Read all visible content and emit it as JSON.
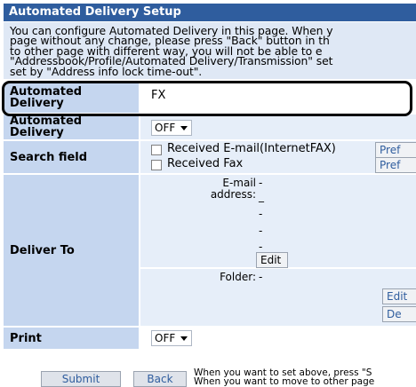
{
  "header": {
    "title": "Automated Delivery Setup"
  },
  "description": {
    "lines": [
      "You can configure Automated Delivery in this page. When y",
      "page without any change, please press \"Back\" button in th",
      "to other page with different way, you will not be able to e",
      "\"Addressbook/Profile/Automated Delivery/Transmission\" set",
      "set by \"Address info lock time-out\"."
    ]
  },
  "rows": {
    "name": {
      "label": "Automated Delivery",
      "value": "FX"
    },
    "enable": {
      "label": "Automated Delivery",
      "selected": "OFF"
    },
    "search": {
      "label": "Search field",
      "option1": "Received E-mail(InternetFAX)",
      "option2": "Received Fax",
      "pref1": "Pref",
      "pref2": "Pref"
    },
    "deliver": {
      "label": "Deliver To",
      "email_label_line1": "E-mail",
      "email_label_line2": "address:",
      "dash": "-",
      "edit_email": "Edit",
      "folder_label": "Folder:",
      "edit_folder": "Edit",
      "delete_folder": "De"
    },
    "print": {
      "label": "Print",
      "selected": "OFF"
    }
  },
  "footer": {
    "submit": "Submit",
    "back": "Back",
    "note_line1": "When you want to set above, press \"S",
    "note_line2": "When you want to move to other page"
  }
}
